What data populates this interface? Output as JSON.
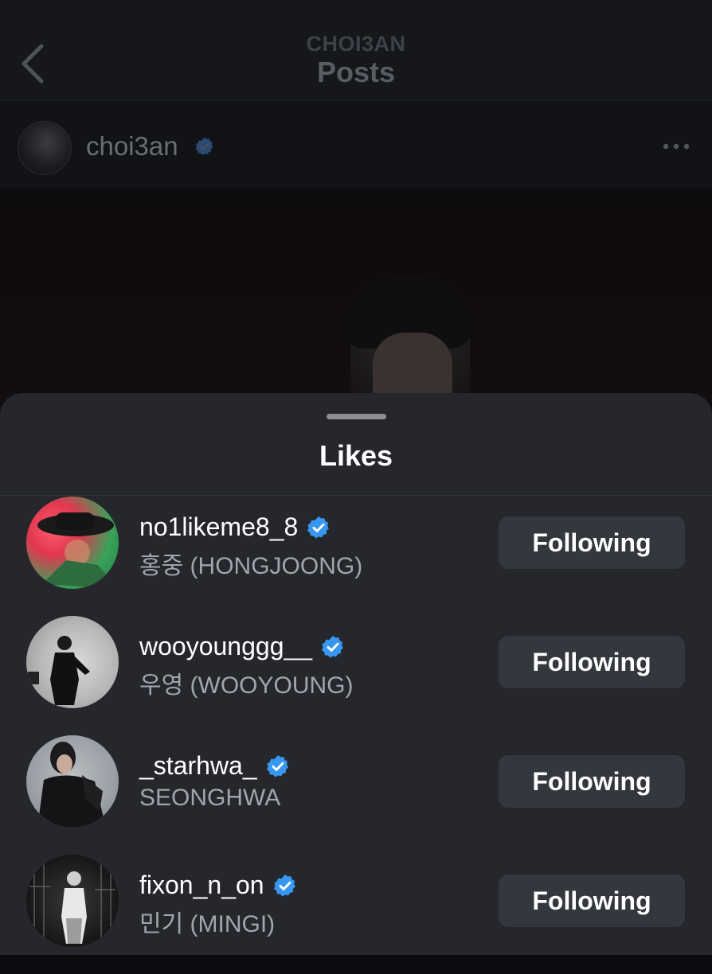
{
  "header": {
    "account": "CHOI3AN",
    "title": "Posts"
  },
  "post": {
    "author": "choi3an",
    "author_verified": true
  },
  "likes_sheet": {
    "title": "Likes",
    "users": [
      {
        "username": "no1likeme8_8",
        "display_name": "홍중 (HONGJOONG)",
        "verified": true,
        "button_label": "Following"
      },
      {
        "username": "wooyounggg__",
        "display_name": "우영 (WOOYOUNG)",
        "verified": true,
        "button_label": "Following"
      },
      {
        "username": "_starhwa_",
        "display_name": "SEONGHWA",
        "verified": true,
        "button_label": "Following"
      },
      {
        "username": "fixon_n_on",
        "display_name": "민기 (MINGI)",
        "verified": true,
        "button_label": "Following"
      }
    ]
  },
  "colors": {
    "sheet_background": "#25272c",
    "button_background": "#34373d",
    "verified_badge": "#3897f0",
    "secondary_text": "#a2a5ab"
  },
  "icons": {
    "back": "chevron-left-icon",
    "more": "more-horizontal-icon",
    "verified": "verified-badge-icon"
  }
}
